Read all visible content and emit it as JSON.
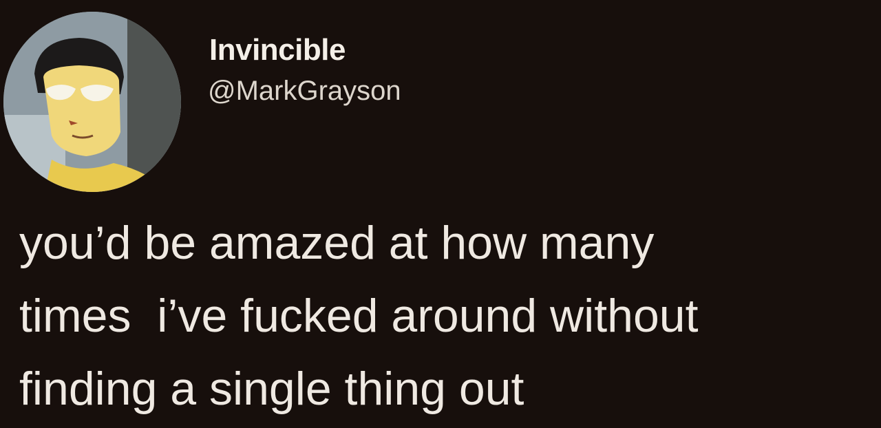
{
  "tweet": {
    "author": {
      "display_name": "Invincible",
      "handle": "@MarkGrayson",
      "avatar_icon": "profile-avatar-image"
    },
    "body_lines": [
      "you’d be amazed at how many",
      "times  i’ve fucked around without",
      "finding a single thing out"
    ]
  },
  "colors": {
    "background": "#170f0c",
    "text": "#efe9e2"
  }
}
